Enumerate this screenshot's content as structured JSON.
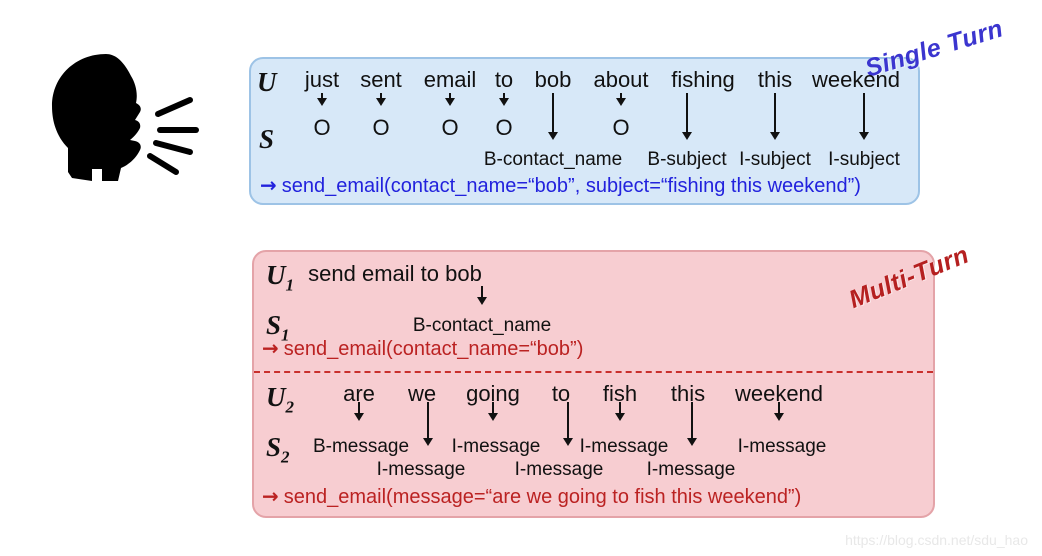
{
  "watermark": "https://blog.csdn.net/sdu_hao",
  "icons": {
    "speaker": "speaking-head-icon"
  },
  "single_turn": {
    "ribbon": "Single Turn",
    "user_label": "U",
    "system_label": "S",
    "words": [
      "just",
      "sent",
      "email",
      "to",
      "bob",
      "about",
      "fishing",
      "this",
      "weekend"
    ],
    "tags": [
      "O",
      "O",
      "O",
      "O",
      "B-contact_name",
      "O",
      "B-subject",
      "I-subject",
      "I-subject"
    ],
    "call": "send_email(contact_name=“bob”, subject=“fishing this weekend”)",
    "call_glyph": "→",
    "color": "#2222dd",
    "panel_bg": "#d7e8f8",
    "panel_border": "#9dc3e6"
  },
  "multi_turn": {
    "ribbon": "Multi-Turn",
    "panel_bg": "#f7cdd1",
    "panel_border": "#e4a3a8",
    "color": "#bb2222",
    "call_glyph": "→",
    "turn1": {
      "user_label": "U",
      "user_sub": "1",
      "system_label": "S",
      "system_sub": "1",
      "utterance": "send email to bob",
      "tag": "B-contact_name",
      "call": "send_email(contact_name=“bob”)"
    },
    "turn2": {
      "user_label": "U",
      "user_sub": "2",
      "system_label": "S",
      "system_sub": "2",
      "words": [
        "are",
        "we",
        "going",
        "to",
        "fish",
        "this",
        "weekend"
      ],
      "tags": [
        "B-message",
        "I-message",
        "I-message",
        "I-message",
        "I-message",
        "I-message",
        "I-message"
      ],
      "call": "send_email(message=“are we going to fish this weekend”)"
    }
  }
}
